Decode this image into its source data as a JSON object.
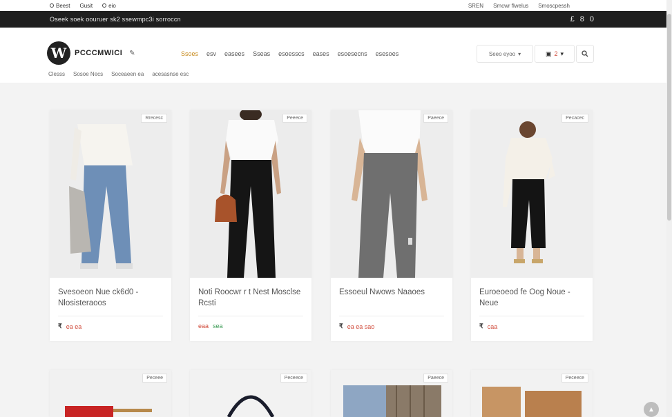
{
  "utility_bar": {
    "left_items": [
      "Beest",
      "Gusit",
      "eio"
    ],
    "right_items": [
      "SREN",
      "Smcwr flwelus",
      "Smoscpessh"
    ]
  },
  "announcement": {
    "text": "Oseek soek oouruer sk2 ssewmpc3i sorroccn",
    "icons": [
      "£",
      "8",
      "0"
    ]
  },
  "header": {
    "logo_text": "PCCCMWICI",
    "nav_items": [
      "Ssoes",
      "esv",
      "easees",
      "Sseas",
      "esoesscs",
      "eases",
      "esoesecns",
      "esesoes"
    ],
    "subnav_items": [
      "Clesss",
      "Sosoe Necs",
      "Soceaeen ea",
      "acesasnse esc"
    ],
    "account_label": "Seeo eyoo",
    "cart_badge": "2"
  },
  "products": [
    {
      "tag": "Rrecesc",
      "title": "Svesoeon Nue ck6d0 - Nlosisteraoos",
      "currency": "₹",
      "price": "ea ea",
      "price2": ""
    },
    {
      "tag": "Peeece",
      "title": "Noti Roocwr r t Nest Mosclse Rcsti",
      "currency": "",
      "price": "eaa",
      "price2": "sea"
    },
    {
      "tag": "Paeece",
      "title": "Essoeul Nwows Naaoes",
      "currency": "₹",
      "price": "ea ea sao",
      "price2": ""
    },
    {
      "tag": "Pecacec",
      "title": "Euroeoeod fe Oog Noue - Neue",
      "currency": "₹",
      "price": "caa",
      "price2": ""
    },
    {
      "tag": "Peceee",
      "title": "",
      "currency": "",
      "price": "",
      "price2": ""
    },
    {
      "tag": "Peceece",
      "title": "",
      "currency": "",
      "price": "",
      "price2": ""
    },
    {
      "tag": "Paeece",
      "title": "",
      "currency": "",
      "price": "",
      "price2": ""
    },
    {
      "tag": "Peceece",
      "title": "",
      "currency": "",
      "price": "",
      "price2": ""
    }
  ],
  "colors": {
    "accent": "#c78a1c",
    "price": "#d04a3a",
    "dark_bar": "#1f1f1f"
  }
}
